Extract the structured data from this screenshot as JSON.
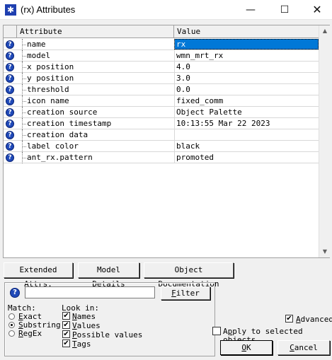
{
  "window": {
    "icon": "star-icon",
    "title": "(rx) Attributes",
    "minimize": "—",
    "maximize": "☐",
    "close": "✕"
  },
  "table": {
    "col_attribute": "Attribute",
    "col_value": "Value",
    "rows": [
      {
        "name": "name",
        "value": "rx"
      },
      {
        "name": "model",
        "value": "wmn_mrt_rx"
      },
      {
        "name": "x position",
        "value": "4.0"
      },
      {
        "name": "y position",
        "value": "3.0"
      },
      {
        "name": "threshold",
        "value": "0.0"
      },
      {
        "name": "icon name",
        "value": "fixed_comm"
      },
      {
        "name": "creation source",
        "value": "Object Palette"
      },
      {
        "name": "creation timestamp",
        "value": "10:13:55 Mar 22 2023"
      },
      {
        "name": "creation data",
        "value": ""
      },
      {
        "name": "label color",
        "value": "black"
      },
      {
        "name": "ant_rx.pattern",
        "value": "promoted"
      }
    ],
    "help_icon_glyph": "?"
  },
  "buttons": {
    "extended_attrs": "Extended Attrs.",
    "model_details": "Model Details",
    "object_documentation": "Object Documentation",
    "filter_prefix": "",
    "filter_mnemonic": "F",
    "filter_rest": "ilter",
    "ok_prefix": "",
    "ok_mnemonic": "O",
    "ok_rest": "K",
    "cancel_prefix": "",
    "cancel_mnemonic": "C",
    "cancel_rest": "ancel"
  },
  "filter": {
    "input_value": "",
    "help_glyph": "?",
    "match_label": "Match:",
    "match_options": [
      {
        "prefix": "",
        "mnemonic": "E",
        "rest": "xact",
        "selected": false
      },
      {
        "prefix": "",
        "mnemonic": "S",
        "rest": "ubstring",
        "selected": true
      },
      {
        "prefix": "",
        "mnemonic": "R",
        "rest": "egEx",
        "selected": false
      }
    ],
    "look_in_label": "Look in:",
    "look_in_options": [
      {
        "prefix": "",
        "mnemonic": "N",
        "rest": "ames",
        "checked": true
      },
      {
        "prefix": "",
        "mnemonic": "V",
        "rest": "alues",
        "checked": true
      },
      {
        "prefix": "",
        "mnemonic": "P",
        "rest": "ossible values",
        "checked": true
      },
      {
        "prefix": "",
        "mnemonic": "T",
        "rest": "ags",
        "checked": true
      }
    ]
  },
  "options": {
    "advanced_prefix": "",
    "advanced_mnemonic": "A",
    "advanced_rest": "dvanced",
    "advanced_checked": true,
    "apply_prefix": "A",
    "apply_mnemonic": "p",
    "apply_rest": "ply to selected objects",
    "apply_checked": false,
    "check_glyph": "✔"
  },
  "colors": {
    "accent": "#0078d7",
    "help_icon": "#1f49b8"
  }
}
